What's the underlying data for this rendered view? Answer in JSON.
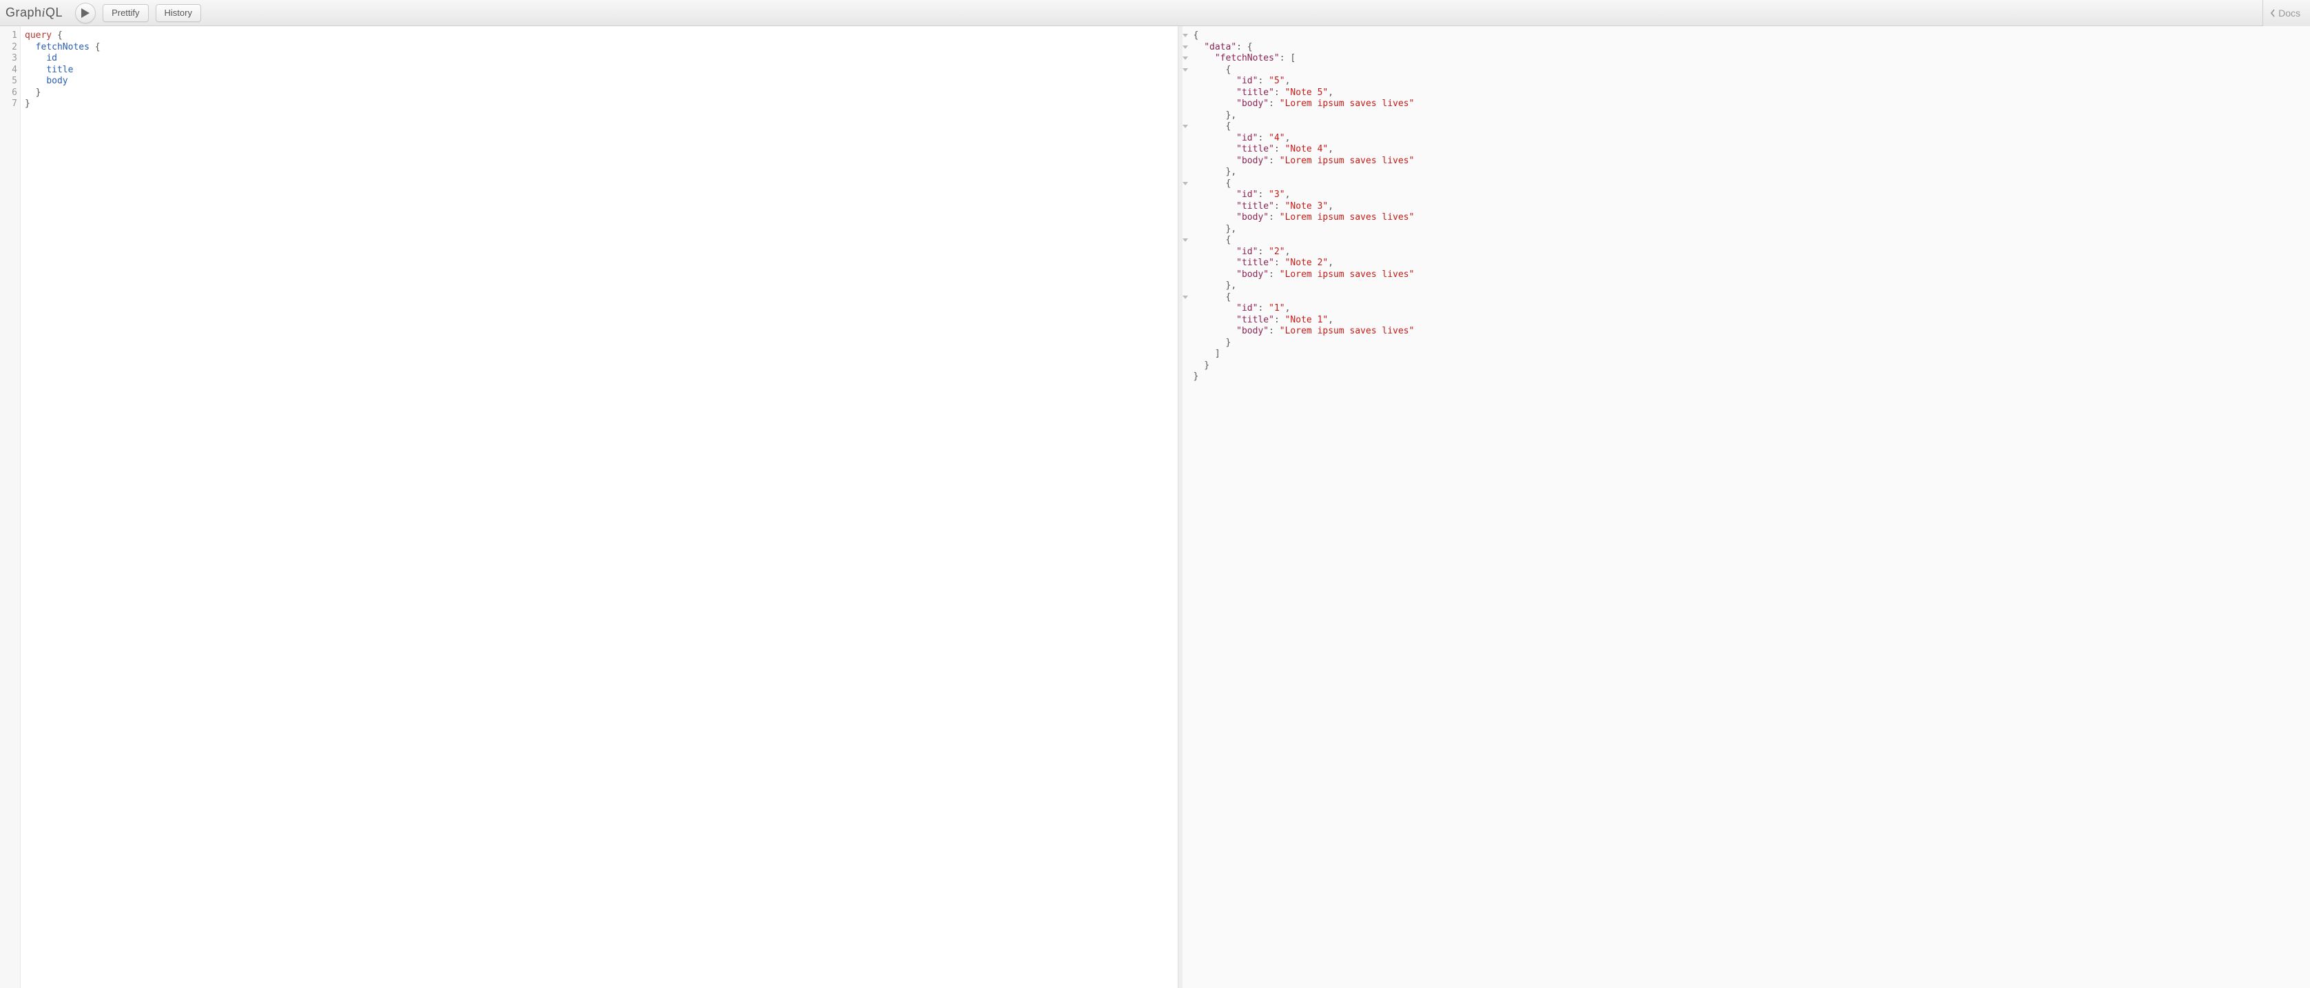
{
  "topbar": {
    "logo_pre": "Graph",
    "logo_i": "i",
    "logo_post": "QL",
    "prettify": "Prettify",
    "history": "History",
    "docs": "Docs"
  },
  "query": {
    "line_numbers": [
      "1",
      "2",
      "3",
      "4",
      "5",
      "6",
      "7"
    ],
    "kw_query": "query",
    "field_fetchNotes": "fetchNotes",
    "field_id": "id",
    "field_title": "title",
    "field_body": "body"
  },
  "result": {
    "key_data": "\"data\"",
    "key_fetchNotes": "\"fetchNotes\"",
    "key_id": "\"id\"",
    "key_title": "\"title\"",
    "key_body": "\"body\"",
    "notes": [
      {
        "id": "\"5\"",
        "title": "\"Note 5\"",
        "body": "\"Lorem ipsum saves lives\""
      },
      {
        "id": "\"4\"",
        "title": "\"Note 4\"",
        "body": "\"Lorem ipsum saves lives\""
      },
      {
        "id": "\"3\"",
        "title": "\"Note 3\"",
        "body": "\"Lorem ipsum saves lives\""
      },
      {
        "id": "\"2\"",
        "title": "\"Note 2\"",
        "body": "\"Lorem ipsum saves lives\""
      },
      {
        "id": "\"1\"",
        "title": "\"Note 1\"",
        "body": "\"Lorem ipsum saves lives\""
      }
    ]
  }
}
